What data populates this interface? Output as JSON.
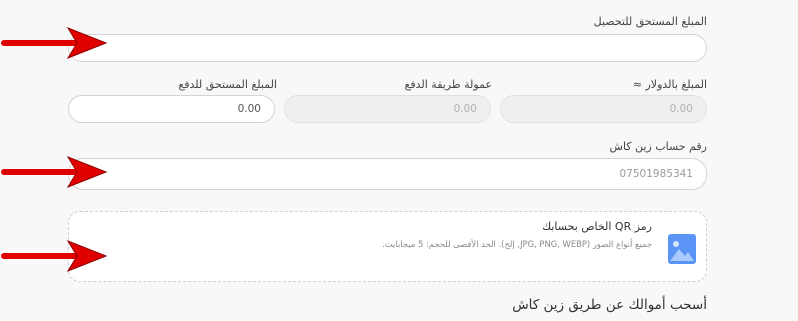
{
  "form": {
    "amount_due_collection": {
      "label": "المبلغ المستحق للتحصيل",
      "value": ""
    },
    "amount_usd": {
      "label": "المبلغ بالدولار ≈",
      "value": "0.00"
    },
    "payment_fee": {
      "label": "عمولة طريقة الدفع",
      "value": "0.00"
    },
    "amount_due_payment": {
      "label": "المبلغ المستحق للدفع",
      "value": "0.00"
    },
    "zaincash_account": {
      "label": "رقم حساب زين كاش",
      "placeholder": "07501985341"
    }
  },
  "qr_upload": {
    "title": "رمز QR الخاص بحسابك",
    "hint": "جميع أنواع الصور (JPG, PNG, WEBP, إلخ). الحد الأقصى للحجم: 5 ميجابايت.",
    "icon": "image-icon"
  },
  "section_heading": "أسحب أموالك عن طريق زين كاش",
  "colors": {
    "arrow": "#e00000",
    "border": "#d4d4d4",
    "icon_blue": "#5a95f5"
  }
}
